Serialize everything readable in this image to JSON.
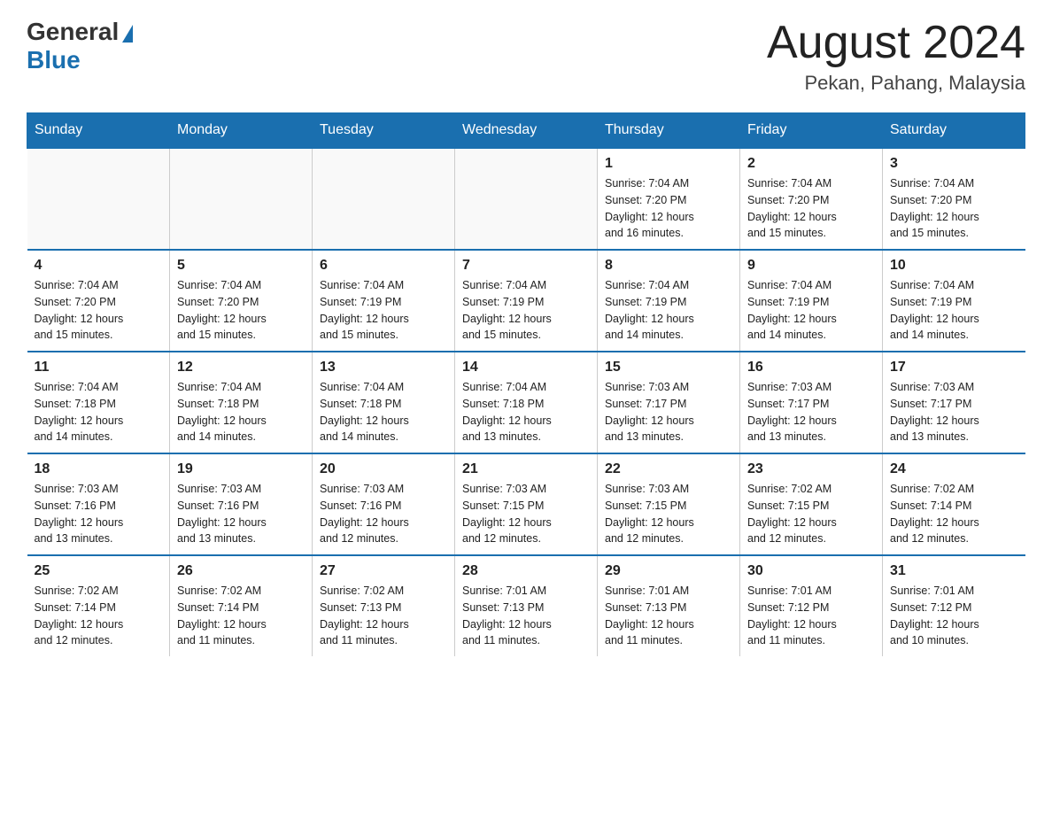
{
  "header": {
    "logo_general": "General",
    "logo_blue": "Blue",
    "month": "August 2024",
    "location": "Pekan, Pahang, Malaysia"
  },
  "days_of_week": [
    "Sunday",
    "Monday",
    "Tuesday",
    "Wednesday",
    "Thursday",
    "Friday",
    "Saturday"
  ],
  "weeks": [
    [
      {
        "day": "",
        "info": ""
      },
      {
        "day": "",
        "info": ""
      },
      {
        "day": "",
        "info": ""
      },
      {
        "day": "",
        "info": ""
      },
      {
        "day": "1",
        "info": "Sunrise: 7:04 AM\nSunset: 7:20 PM\nDaylight: 12 hours\nand 16 minutes."
      },
      {
        "day": "2",
        "info": "Sunrise: 7:04 AM\nSunset: 7:20 PM\nDaylight: 12 hours\nand 15 minutes."
      },
      {
        "day": "3",
        "info": "Sunrise: 7:04 AM\nSunset: 7:20 PM\nDaylight: 12 hours\nand 15 minutes."
      }
    ],
    [
      {
        "day": "4",
        "info": "Sunrise: 7:04 AM\nSunset: 7:20 PM\nDaylight: 12 hours\nand 15 minutes."
      },
      {
        "day": "5",
        "info": "Sunrise: 7:04 AM\nSunset: 7:20 PM\nDaylight: 12 hours\nand 15 minutes."
      },
      {
        "day": "6",
        "info": "Sunrise: 7:04 AM\nSunset: 7:19 PM\nDaylight: 12 hours\nand 15 minutes."
      },
      {
        "day": "7",
        "info": "Sunrise: 7:04 AM\nSunset: 7:19 PM\nDaylight: 12 hours\nand 15 minutes."
      },
      {
        "day": "8",
        "info": "Sunrise: 7:04 AM\nSunset: 7:19 PM\nDaylight: 12 hours\nand 14 minutes."
      },
      {
        "day": "9",
        "info": "Sunrise: 7:04 AM\nSunset: 7:19 PM\nDaylight: 12 hours\nand 14 minutes."
      },
      {
        "day": "10",
        "info": "Sunrise: 7:04 AM\nSunset: 7:19 PM\nDaylight: 12 hours\nand 14 minutes."
      }
    ],
    [
      {
        "day": "11",
        "info": "Sunrise: 7:04 AM\nSunset: 7:18 PM\nDaylight: 12 hours\nand 14 minutes."
      },
      {
        "day": "12",
        "info": "Sunrise: 7:04 AM\nSunset: 7:18 PM\nDaylight: 12 hours\nand 14 minutes."
      },
      {
        "day": "13",
        "info": "Sunrise: 7:04 AM\nSunset: 7:18 PM\nDaylight: 12 hours\nand 14 minutes."
      },
      {
        "day": "14",
        "info": "Sunrise: 7:04 AM\nSunset: 7:18 PM\nDaylight: 12 hours\nand 13 minutes."
      },
      {
        "day": "15",
        "info": "Sunrise: 7:03 AM\nSunset: 7:17 PM\nDaylight: 12 hours\nand 13 minutes."
      },
      {
        "day": "16",
        "info": "Sunrise: 7:03 AM\nSunset: 7:17 PM\nDaylight: 12 hours\nand 13 minutes."
      },
      {
        "day": "17",
        "info": "Sunrise: 7:03 AM\nSunset: 7:17 PM\nDaylight: 12 hours\nand 13 minutes."
      }
    ],
    [
      {
        "day": "18",
        "info": "Sunrise: 7:03 AM\nSunset: 7:16 PM\nDaylight: 12 hours\nand 13 minutes."
      },
      {
        "day": "19",
        "info": "Sunrise: 7:03 AM\nSunset: 7:16 PM\nDaylight: 12 hours\nand 13 minutes."
      },
      {
        "day": "20",
        "info": "Sunrise: 7:03 AM\nSunset: 7:16 PM\nDaylight: 12 hours\nand 12 minutes."
      },
      {
        "day": "21",
        "info": "Sunrise: 7:03 AM\nSunset: 7:15 PM\nDaylight: 12 hours\nand 12 minutes."
      },
      {
        "day": "22",
        "info": "Sunrise: 7:03 AM\nSunset: 7:15 PM\nDaylight: 12 hours\nand 12 minutes."
      },
      {
        "day": "23",
        "info": "Sunrise: 7:02 AM\nSunset: 7:15 PM\nDaylight: 12 hours\nand 12 minutes."
      },
      {
        "day": "24",
        "info": "Sunrise: 7:02 AM\nSunset: 7:14 PM\nDaylight: 12 hours\nand 12 minutes."
      }
    ],
    [
      {
        "day": "25",
        "info": "Sunrise: 7:02 AM\nSunset: 7:14 PM\nDaylight: 12 hours\nand 12 minutes."
      },
      {
        "day": "26",
        "info": "Sunrise: 7:02 AM\nSunset: 7:14 PM\nDaylight: 12 hours\nand 11 minutes."
      },
      {
        "day": "27",
        "info": "Sunrise: 7:02 AM\nSunset: 7:13 PM\nDaylight: 12 hours\nand 11 minutes."
      },
      {
        "day": "28",
        "info": "Sunrise: 7:01 AM\nSunset: 7:13 PM\nDaylight: 12 hours\nand 11 minutes."
      },
      {
        "day": "29",
        "info": "Sunrise: 7:01 AM\nSunset: 7:13 PM\nDaylight: 12 hours\nand 11 minutes."
      },
      {
        "day": "30",
        "info": "Sunrise: 7:01 AM\nSunset: 7:12 PM\nDaylight: 12 hours\nand 11 minutes."
      },
      {
        "day": "31",
        "info": "Sunrise: 7:01 AM\nSunset: 7:12 PM\nDaylight: 12 hours\nand 10 minutes."
      }
    ]
  ]
}
